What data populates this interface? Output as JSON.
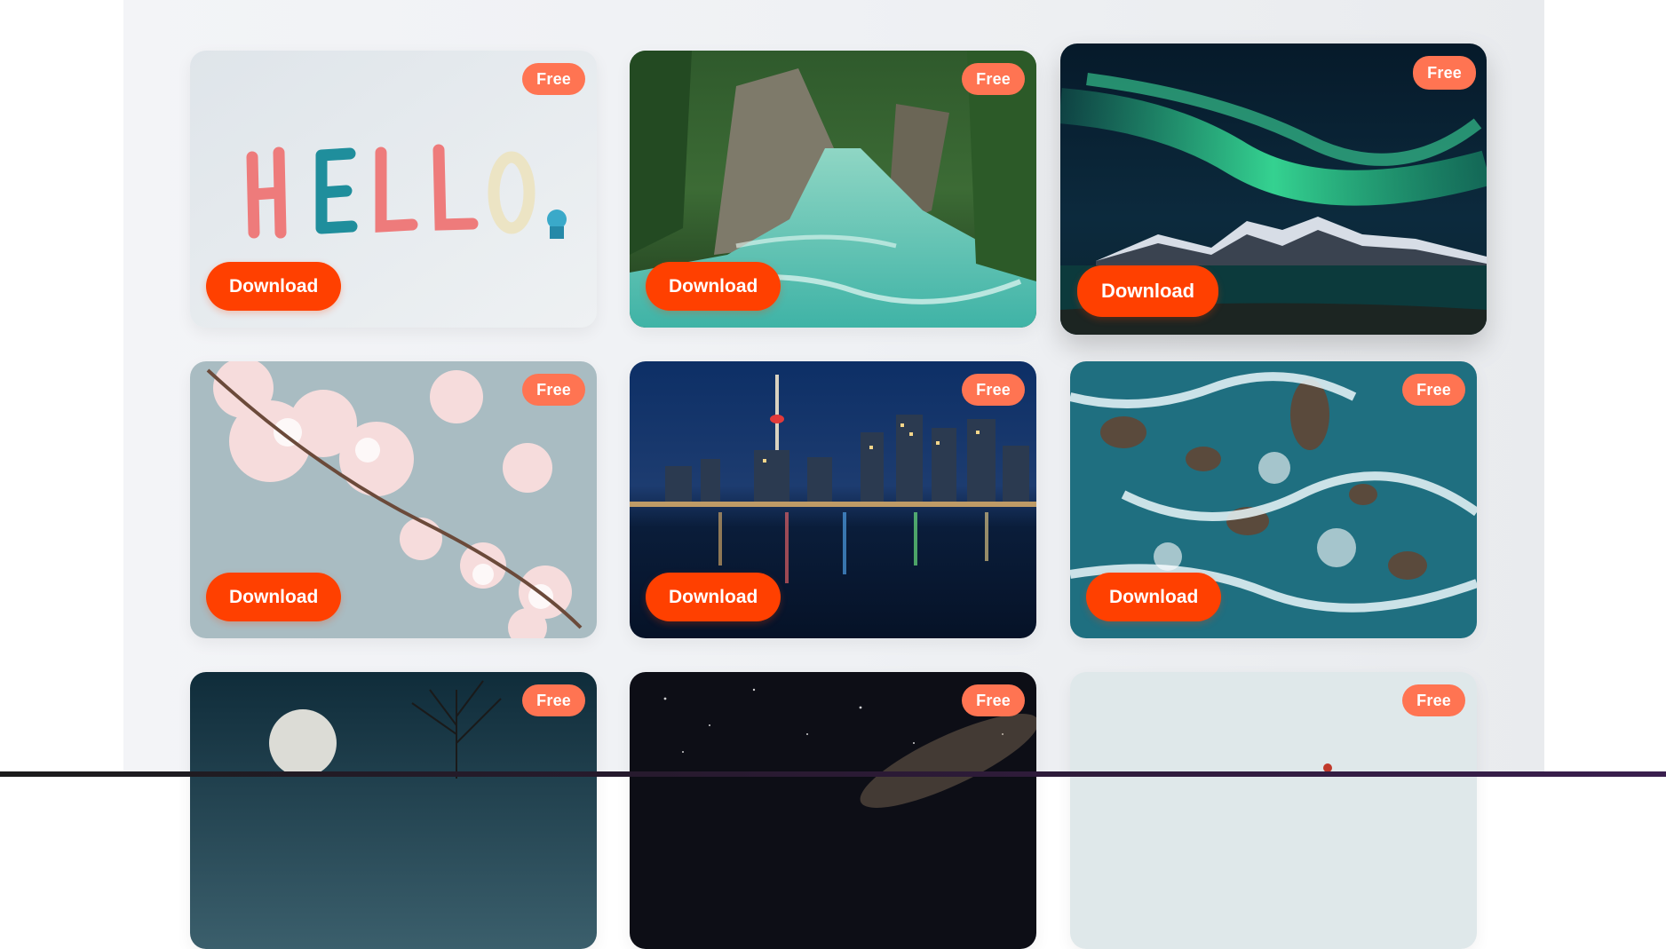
{
  "gallery": {
    "cards": [
      {
        "subject": "hello-clay-letters",
        "badge": "Free",
        "button": "Download"
      },
      {
        "subject": "forest-river",
        "badge": "Free",
        "button": "Download"
      },
      {
        "subject": "northern-lights",
        "badge": "Free",
        "button": "Download"
      },
      {
        "subject": "cherry-blossoms",
        "badge": "Free",
        "button": "Download"
      },
      {
        "subject": "city-skyline-night",
        "badge": "Free",
        "button": "Download"
      },
      {
        "subject": "ocean-waves-rocks",
        "badge": "Free",
        "button": "Download"
      },
      {
        "subject": "full-moon-tree",
        "badge": "Free"
      },
      {
        "subject": "milky-way",
        "badge": "Free"
      },
      {
        "subject": "misty-landscape",
        "badge": "Free"
      }
    ]
  },
  "colors": {
    "badge_bg": "#ff7452",
    "button_bg": "#ff4000",
    "page_bg": "#f0f2f5"
  }
}
